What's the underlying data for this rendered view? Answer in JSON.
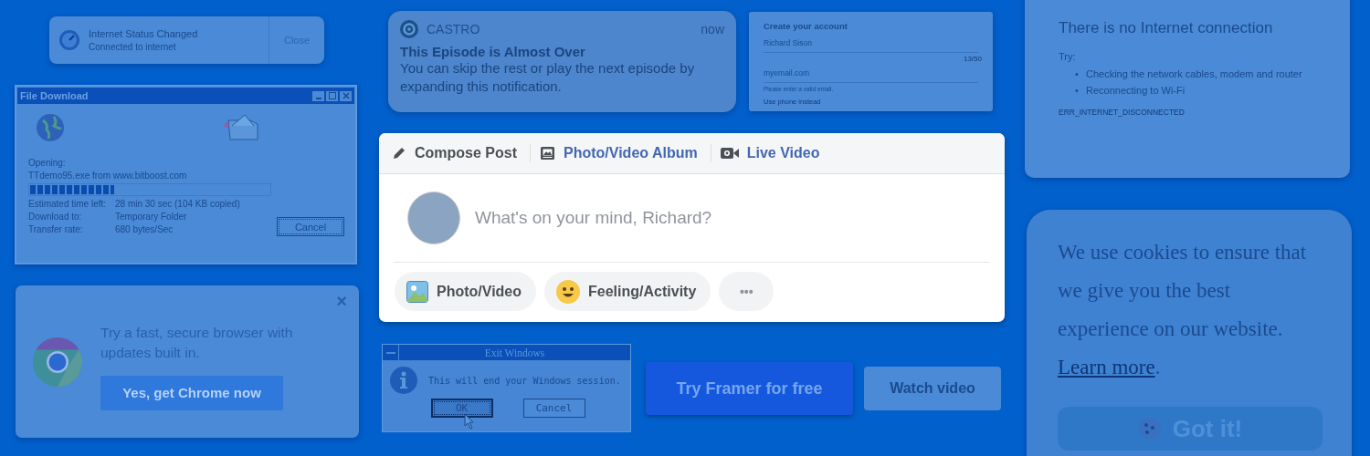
{
  "connection_notice": {
    "title": "Internet Status Changed",
    "message": "Connected to internet",
    "close": "Close"
  },
  "file_download": {
    "title": "File Download",
    "opening_label": "Opening:",
    "file": "TTdemo95.exe from www.bitboost.com",
    "level": 0.35,
    "cancel": "Cancel",
    "rows": [
      {
        "label": "Estimated time left:",
        "value": "28 min 30 sec (104 KB copied)"
      },
      {
        "label": "Download to:",
        "value": "Temporary Folder"
      },
      {
        "label": "Transfer rate:",
        "value": "680 bytes/Sec"
      }
    ]
  },
  "chrome_promo": {
    "close": "×",
    "message": "Try a fast, secure browser with updates built in.",
    "button": "Yes, get Chrome now"
  },
  "notification": {
    "app": "CASTRO",
    "time": "now",
    "title": "This Episode is Almost Over",
    "body": "You can skip the rest or play the next episode by expanding this notification."
  },
  "signup": {
    "title": "Create your account",
    "name": "Richard Sison",
    "counter": "13/50",
    "email": "myemail.com",
    "error": "Please enter a valid email.",
    "link": "Use phone instead"
  },
  "composer": {
    "tabs": [
      {
        "label": "Compose Post",
        "selected": true,
        "kind": "pencil"
      },
      {
        "label": "Photo/Video Album",
        "selected": false,
        "kind": "album"
      },
      {
        "label": "Live Video",
        "selected": false,
        "kind": "camera"
      }
    ],
    "placeholder": "What's on your mind, Richard?",
    "actions": [
      {
        "label": "Photo/Video",
        "kind": "photo"
      },
      {
        "label": "Feeling/Activity",
        "kind": "emoji"
      }
    ],
    "more": "•••"
  },
  "exit_dialog": {
    "title": "Exit Windows",
    "message": "This will end your Windows session.",
    "buttons": [
      {
        "label": "OK",
        "selected": true
      },
      {
        "label": "Cancel",
        "selected": false
      }
    ]
  },
  "cta": {
    "primary": "Try Framer for free",
    "secondary": "Watch video"
  },
  "offline": {
    "title": "There is no Internet connection",
    "try": "Try:",
    "bullet": "•",
    "suggestions": [
      "Checking the network cables, modem and router",
      "Reconnecting to Wi-Fi"
    ],
    "code": "ERR_INTERNET_DISCONNECTED"
  },
  "cookies": {
    "message": "We use cookies to ensure that we give you the best experience on our website.",
    "link": "Learn more",
    "after": ".",
    "button": "Got it!"
  }
}
